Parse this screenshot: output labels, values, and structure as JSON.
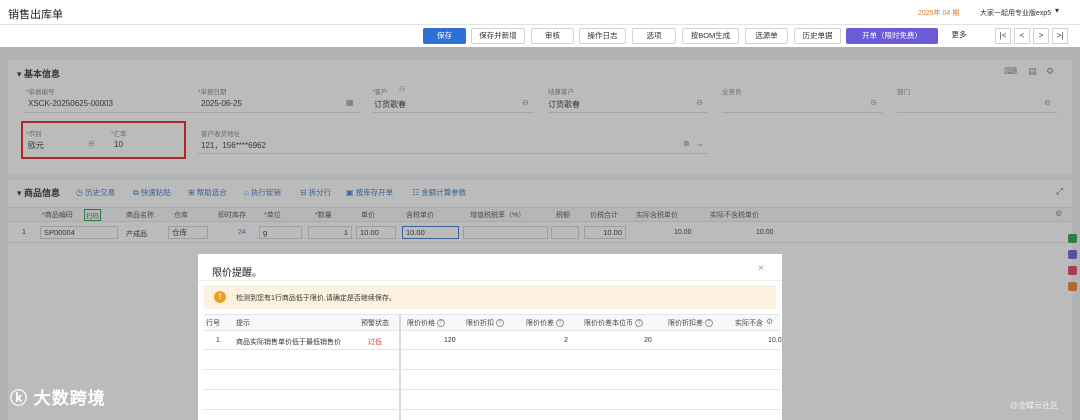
{
  "header": {
    "title": "销售出库单",
    "period": "2025年 04 期",
    "account": "大家一起用专业版exp5"
  },
  "toolbar": {
    "buttons": [
      "保存",
      "保存并新增",
      "审核",
      "操作日志",
      "选项",
      "按BOM生成",
      "选源单",
      "历史单据",
      "开单（限时免费）",
      "更多"
    ],
    "nav": [
      "|<",
      "<",
      ">",
      ">|"
    ]
  },
  "basic": {
    "section_title": "基本信息",
    "bill_no_label": "*单据编号",
    "bill_no": "XSCK-20250625-00003",
    "date_label": "*单据日期",
    "date": "2025-06-25",
    "customer_label": "*客户",
    "customer": "订货歌春",
    "settle_label": "结算客户",
    "settle": "订货歌春",
    "salesman_label": "业务员",
    "salesman": "",
    "dept_label": "部门",
    "dept": "",
    "currency_label": "*币别",
    "currency": "欧元",
    "rate_label": "*汇率",
    "rate": "10",
    "address_label": "客户收货地址",
    "address": "121，156****6962"
  },
  "goods": {
    "section_title": "商品信息",
    "actions": [
      "历史交易",
      "快速粘贴",
      "帮助选合",
      "执行促销",
      "拆分行",
      "按库存开单",
      "金额计算参数"
    ],
    "columns": [
      "*商品编码",
      "商品名称",
      "仓库",
      "即时库存",
      "*单位",
      "*数量",
      "单价",
      "含税单价",
      "增值税税率（%）",
      "税额",
      "价税合计",
      "实际含税单价",
      "实际不含税单价"
    ],
    "barcode_tag": "扫码",
    "rows": [
      {
        "no": "1",
        "code": "SP00004",
        "name": "产成品",
        "warehouse": "仓库",
        "stock": "24",
        "unit": "g",
        "qty": "1",
        "price": "10.00",
        "tax_price": "10.00",
        "tax_rate": "",
        "tax": "",
        "total": "10.00",
        "real_tax_price": "10.00",
        "real_price": "10.00"
      }
    ]
  },
  "dialog": {
    "title": "限价提醒。",
    "message": "检测到您有1行商品低于限价,请确定是否继续保存。",
    "columns": [
      "行号",
      "提示",
      "预警状态",
      "限价价格",
      "限价折扣",
      "限价价差",
      "限价价差本位币",
      "限价折扣差",
      "实际不含"
    ],
    "rows": [
      {
        "no": "1",
        "tip": "商品实际销售单价低于最低销售价",
        "status": "过低",
        "price": "120",
        "discount": "",
        "diff": "2",
        "diff_base": "20",
        "discount_diff": "",
        "real": "10.0"
      }
    ]
  },
  "watermark": {
    "left": "大数跨境",
    "right": "@金蝶云社区"
  },
  "colors": {
    "primary": "#2f6fd6",
    "warning": "#f0a020",
    "danger": "#e02020",
    "status_low": "#e0402a"
  }
}
